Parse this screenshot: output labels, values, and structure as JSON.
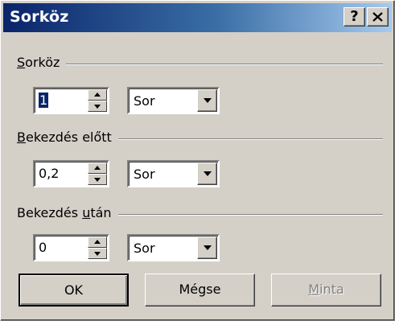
{
  "dialog": {
    "title": "Sorköz",
    "help_label": "?"
  },
  "groups": [
    {
      "label_first": "S",
      "label_rest": "orköz",
      "value": "1",
      "unit": "Sor"
    },
    {
      "label_first": "B",
      "label_rest": "ekezdés előtt",
      "value": "0,2",
      "unit": "Sor"
    },
    {
      "label_pre": "Bekezdés ",
      "label_u": "u",
      "label_post": "tán",
      "value": "0",
      "unit": "Sor"
    }
  ],
  "buttons": {
    "ok": "OK",
    "cancel": "Mégse",
    "preview_first": "M",
    "preview_rest": "inta"
  }
}
